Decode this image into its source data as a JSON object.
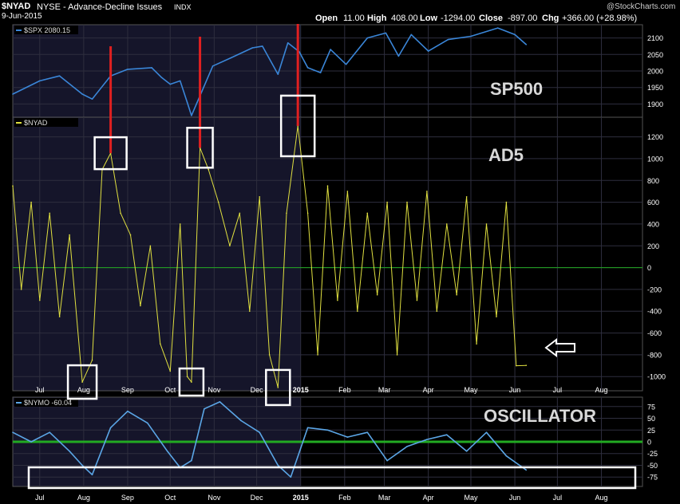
{
  "header": {
    "symbol": "$NYAD",
    "name": "NYSE - Advance-Decline Issues",
    "exchange": "INDX",
    "date": "9-Jun-2015",
    "watermark": "@StockCharts.com",
    "open_label": "Open",
    "open": "11.00",
    "high_label": "High",
    "high": "408.00",
    "low_label": "Low",
    "low": "-1294.00",
    "close_label": "Close",
    "close": "-897.00",
    "chg_label": "Chg",
    "chg": "+366.00 (+28.98%)"
  },
  "colors": {
    "spx": "#3a86d8",
    "ad": "#e0e040",
    "nymo": "#5ba6e6",
    "zero": "#22aa22",
    "red": "#e02020",
    "box": "#ffffff"
  },
  "annotations": {
    "sp500": "SP500",
    "ad5": "AD5",
    "osc": "OSCILLATOR"
  },
  "chart_data": [
    {
      "type": "line",
      "title": "SP500",
      "legend": "$SPX 2080.15",
      "yticks": [
        "2100",
        "2050",
        "2000",
        "1950",
        "1900"
      ],
      "ylim": [
        1860,
        2140
      ],
      "x": [
        "2014-06-12",
        "2014-07-01",
        "2014-07-15",
        "2014-07-31",
        "2014-08-07",
        "2014-08-20",
        "2014-09-01",
        "2014-09-18",
        "2014-09-25",
        "2014-10-01",
        "2014-10-08",
        "2014-10-13",
        "2014-10-16",
        "2014-10-20",
        "2014-10-31",
        "2014-11-13",
        "2014-11-28",
        "2014-12-05",
        "2014-12-16",
        "2014-12-23",
        "2014-12-31",
        "2015-01-06",
        "2015-01-15",
        "2015-01-22",
        "2015-02-02",
        "2015-02-17",
        "2015-03-02",
        "2015-03-11",
        "2015-03-20",
        "2015-04-01",
        "2015-04-15",
        "2015-05-01",
        "2015-05-20",
        "2015-06-01",
        "2015-06-09"
      ],
      "values": [
        1930,
        1970,
        1985,
        1930,
        1915,
        1985,
        2005,
        2010,
        1980,
        1960,
        1970,
        1905,
        1865,
        1905,
        2015,
        2040,
        2070,
        2075,
        1990,
        2085,
        2058,
        2010,
        1995,
        2065,
        2020,
        2100,
        2115,
        2045,
        2110,
        2060,
        2095,
        2105,
        2130,
        2110,
        2080
      ]
    },
    {
      "type": "line",
      "title": "AD5",
      "legend": "$NYAD",
      "yticks": [
        "1200",
        "1000",
        "800",
        "600",
        "400",
        "200",
        "0",
        "-200",
        "-400",
        "-600",
        "-800",
        "-1000"
      ],
      "ylim": [
        -1130,
        1380
      ],
      "x": [
        "2014-06-12",
        "2014-06-18",
        "2014-06-25",
        "2014-07-01",
        "2014-07-08",
        "2014-07-15",
        "2014-07-22",
        "2014-07-31",
        "2014-08-07",
        "2014-08-14",
        "2014-08-20",
        "2014-08-27",
        "2014-09-03",
        "2014-09-10",
        "2014-09-17",
        "2014-09-24",
        "2014-10-01",
        "2014-10-08",
        "2014-10-13",
        "2014-10-16",
        "2014-10-22",
        "2014-10-28",
        "2014-11-04",
        "2014-11-12",
        "2014-11-19",
        "2014-11-26",
        "2014-12-03",
        "2014-12-10",
        "2014-12-16",
        "2014-12-22",
        "2014-12-30",
        "2015-01-06",
        "2015-01-13",
        "2015-01-20",
        "2015-01-27",
        "2015-02-03",
        "2015-02-10",
        "2015-02-17",
        "2015-02-24",
        "2015-03-03",
        "2015-03-10",
        "2015-03-17",
        "2015-03-24",
        "2015-03-31",
        "2015-04-07",
        "2015-04-14",
        "2015-04-21",
        "2015-04-28",
        "2015-05-05",
        "2015-05-12",
        "2015-05-19",
        "2015-05-26",
        "2015-06-02",
        "2015-06-09"
      ],
      "values": [
        750,
        -200,
        600,
        -300,
        500,
        -450,
        300,
        -1050,
        -850,
        900,
        1050,
        500,
        300,
        -350,
        200,
        -700,
        -950,
        400,
        -1000,
        -1050,
        1100,
        900,
        600,
        200,
        500,
        -400,
        650,
        -800,
        -1100,
        500,
        1300,
        500,
        -800,
        750,
        -300,
        700,
        -400,
        500,
        -250,
        600,
        -800,
        600,
        -300,
        700,
        -400,
        400,
        -250,
        650,
        -700,
        400,
        -450,
        600,
        -900,
        -897
      ]
    },
    {
      "type": "line",
      "title": "OSCILLATOR",
      "legend": "$NYMO -60.04",
      "yticks": [
        "75",
        "50",
        "25",
        "0",
        "-25",
        "-50",
        "-75"
      ],
      "ylim": [
        -95,
        95
      ],
      "x": [
        "2014-06-12",
        "2014-06-25",
        "2014-07-08",
        "2014-07-22",
        "2014-07-31",
        "2014-08-07",
        "2014-08-20",
        "2014-09-01",
        "2014-09-15",
        "2014-09-29",
        "2014-10-08",
        "2014-10-16",
        "2014-10-25",
        "2014-11-05",
        "2014-11-20",
        "2014-12-03",
        "2014-12-16",
        "2014-12-25",
        "2015-01-06",
        "2015-01-20",
        "2015-02-03",
        "2015-02-17",
        "2015-03-03",
        "2015-03-17",
        "2015-03-31",
        "2015-04-14",
        "2015-04-28",
        "2015-05-12",
        "2015-05-26",
        "2015-06-09"
      ],
      "values": [
        20,
        0,
        20,
        -20,
        -50,
        -70,
        30,
        65,
        40,
        -20,
        -55,
        -40,
        70,
        85,
        45,
        20,
        -50,
        -75,
        30,
        25,
        10,
        20,
        -40,
        -10,
        5,
        15,
        -20,
        20,
        -30,
        -60
      ]
    }
  ],
  "xaxis": {
    "ticks": [
      "Jul",
      "Aug",
      "Sep",
      "Oct",
      "Nov",
      "Dec",
      "2015",
      "Feb",
      "Mar",
      "Apr",
      "May",
      "Jun",
      "Jul",
      "Aug"
    ],
    "dates": [
      "2014-07-01",
      "2014-08-01",
      "2014-09-01",
      "2014-10-01",
      "2014-11-01",
      "2014-12-01",
      "2015-01-01",
      "2015-02-01",
      "2015-03-01",
      "2015-04-01",
      "2015-05-01",
      "2015-06-01",
      "2015-07-01",
      "2015-08-01"
    ],
    "start": "2014-06-12",
    "end": "2015-08-30",
    "shade_end": "2015-01-01"
  }
}
